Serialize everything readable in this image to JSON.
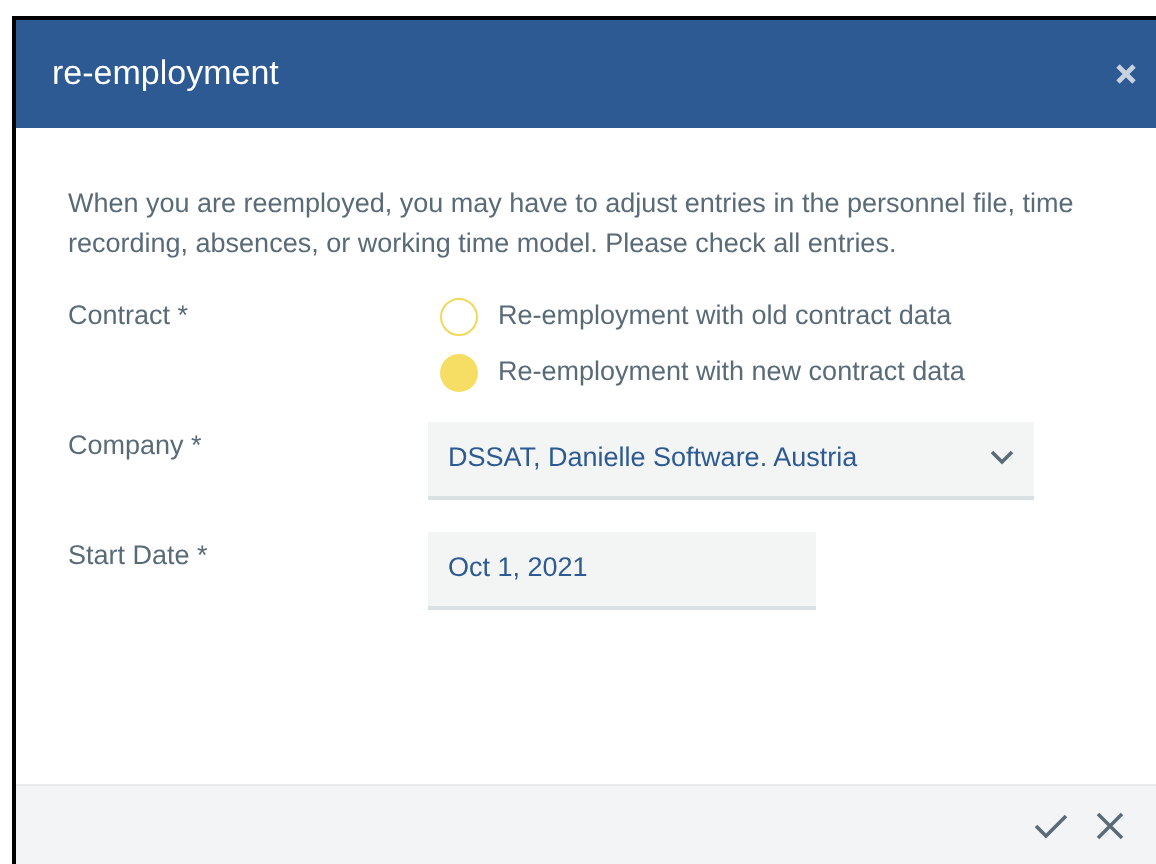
{
  "dialog": {
    "title": "re-employment",
    "message": "When you are reemployed, you may have to adjust entries in the personnel file, time recording, absences, or working time model. Please check all entries.",
    "fields": [
      {
        "kind": "radio",
        "label": "Contract *",
        "options": [
          {
            "label": "Re-employment with old contract data",
            "selected": false
          },
          {
            "label": "Re-employment with new contract data",
            "selected": true
          }
        ]
      },
      {
        "kind": "select",
        "label": "Company *",
        "value": "DSSAT, Danielle Software. Austria"
      },
      {
        "kind": "date",
        "label": "Start Date *",
        "value": "Oct 1, 2021"
      }
    ]
  }
}
